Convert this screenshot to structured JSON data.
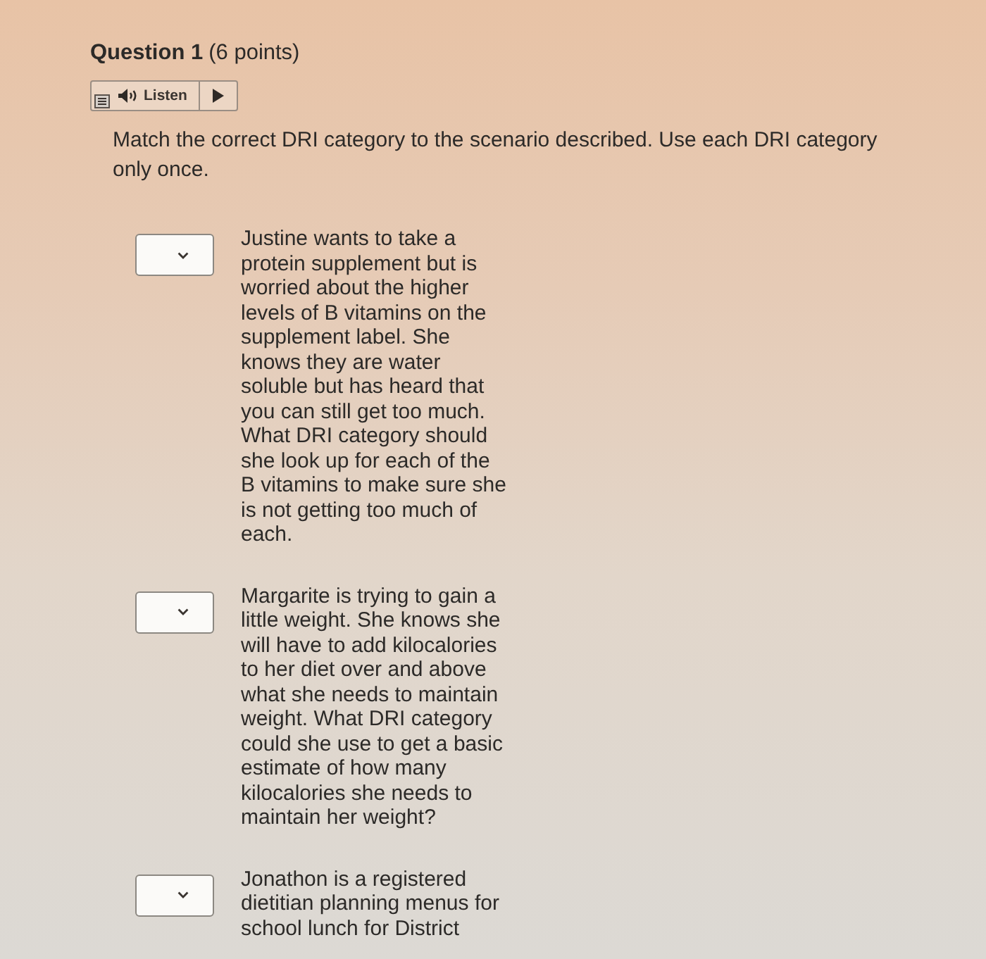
{
  "question": {
    "title": "Question 1",
    "points": "(6 points)"
  },
  "listen_bar": {
    "label": "Listen"
  },
  "instructions": "Match the correct DRI category to the scenario described. Use each DRI category only once.",
  "items": [
    {
      "scenario": "Justine wants to take a protein supplement but is worried about the higher levels of B vitamins on the supplement label. She knows they are water soluble but has heard that you can still get too much. What DRI category should she look up for each of the B vitamins to make sure she is not getting too much of each."
    },
    {
      "scenario": "Margarite is trying to gain a little weight. She knows she will have to add kilocalories to her diet over and above what she needs to maintain weight. What DRI category could she use to get a basic estimate of how many kilocalories she needs to maintain her weight?"
    },
    {
      "scenario": "Jonathon is a registered dietitian planning menus for school lunch for District"
    }
  ]
}
